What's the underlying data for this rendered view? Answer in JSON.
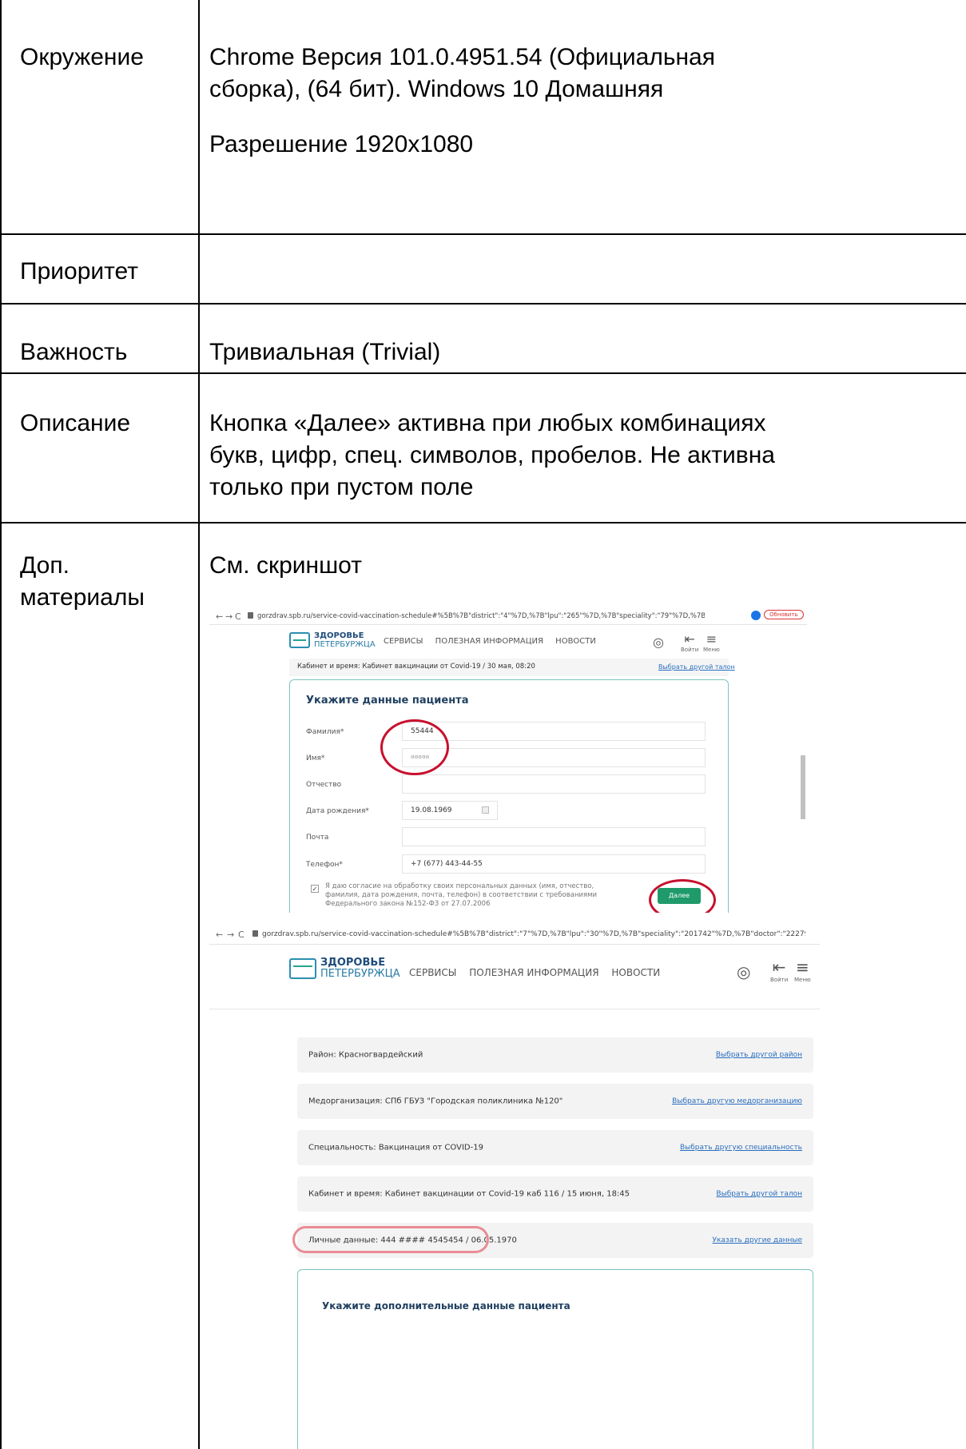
{
  "table": {
    "rows": [
      {
        "label": "Окружение",
        "value_lines": [
          "Chrome Версия 101.0.4951.54 (Официальная",
          "сборка), (64 бит). Windows 10 Домашняя"
        ],
        "extra": "Разрешение 1920x1080"
      },
      {
        "label": "Приоритет",
        "value": ""
      },
      {
        "label": "Важность",
        "value": "Тривиальная (Trivial)"
      },
      {
        "label": "Описание",
        "value_lines": [
          "Кнопка «Далее» активна при любых комбинациях",
          "букв, цифр, спец. символов, пробелов. Не активна",
          "только при пустом поле"
        ]
      },
      {
        "label_lines": [
          "Доп.",
          "материалы"
        ],
        "value": "См. скриншот"
      }
    ]
  },
  "screenshot1": {
    "url": "gorzdrav.spb.ru/service-covid-vaccination-schedule#%5B%7B\"district\":\"4\"%7D,%7B\"lpu\":\"265\"%7D,%7B\"speciality\":\"79\"%7D,%7B\"appointment\":\"1\"%7D,%7B\"patient\":\"1\"%7D...",
    "profile_btn": "Обновить",
    "logo_line1": "ЗДОРОВЬЕ",
    "logo_line2": "ПЕТЕРБУРЖЦА",
    "menu": [
      "СЕРВИСЫ",
      "ПОЛЕЗНАЯ ИНФОРМАЦИЯ",
      "НОВОСТИ"
    ],
    "login": "Войти",
    "menu_label": "Меню",
    "cabinet": "Кабинет и время: Кабинет вакцинации от Covid-19 / 30 мая, 08:20",
    "cabinet_link": "Выбрать другой талон",
    "form_title": "Укажите данные пациента",
    "fields": [
      {
        "label": "Фамилия*",
        "value": "55444"
      },
      {
        "label": "Имя*",
        "value": "ɞɞɞɞɞ"
      },
      {
        "label": "Отчество",
        "value": ""
      },
      {
        "label": "Дата рождения*",
        "value": "19.08.1969"
      },
      {
        "label": "Почта",
        "value": ""
      },
      {
        "label": "Телефон*",
        "value": "+7 (677) 443-44-55"
      }
    ],
    "consent": "Я даю согласие на обработку своих персональных данных (имя, отчество, фамилия, дата рождения, почта, телефон) в соответствии с требованиями Федерального закона №152-ФЗ от 27.07.2006",
    "next_button": "Далее"
  },
  "screenshot2": {
    "url": "gorzdrav.spb.ru/service-covid-vaccination-schedule#%5B%7B\"district\":\"7\"%7D,%7B\"lpu\":\"30\"%7D,%7B\"speciality\":\"201742\"%7D,%7B\"doctor\":\"222795\"%7D,%7B\"appointment\":\"1\"%7D...",
    "logo_line1": "ЗДОРОВЬЕ",
    "logo_line2": "ПЕТЕРБУРЖЦА",
    "menu": [
      "СЕРВИСЫ",
      "ПОЛЕЗНАЯ ИНФОРМАЦИЯ",
      "НОВОСТИ"
    ],
    "login": "Войти",
    "menu_label": "Меню",
    "rows": [
      {
        "text": "Район: Красногвардейский",
        "link": "Выбрать другой район"
      },
      {
        "text": "Медорганизация: СПб ГБУЗ \"Городская поликлиника №120\"",
        "link": "Выбрать другую медорганизацию"
      },
      {
        "text": "Специальность: Вакцинация от COVID-19",
        "link": "Выбрать другую специальность"
      },
      {
        "text": "Кабинет и время: Кабинет вакцинации от Covid-19 каб 116 / 15 июня, 18:45",
        "link": "Выбрать другой талон"
      },
      {
        "text": "Личные данные: 444 #### 4545454 / 06.05.1970",
        "link": "Указать другие данные"
      }
    ],
    "form_title": "Укажите дополнительные данные пациента"
  }
}
